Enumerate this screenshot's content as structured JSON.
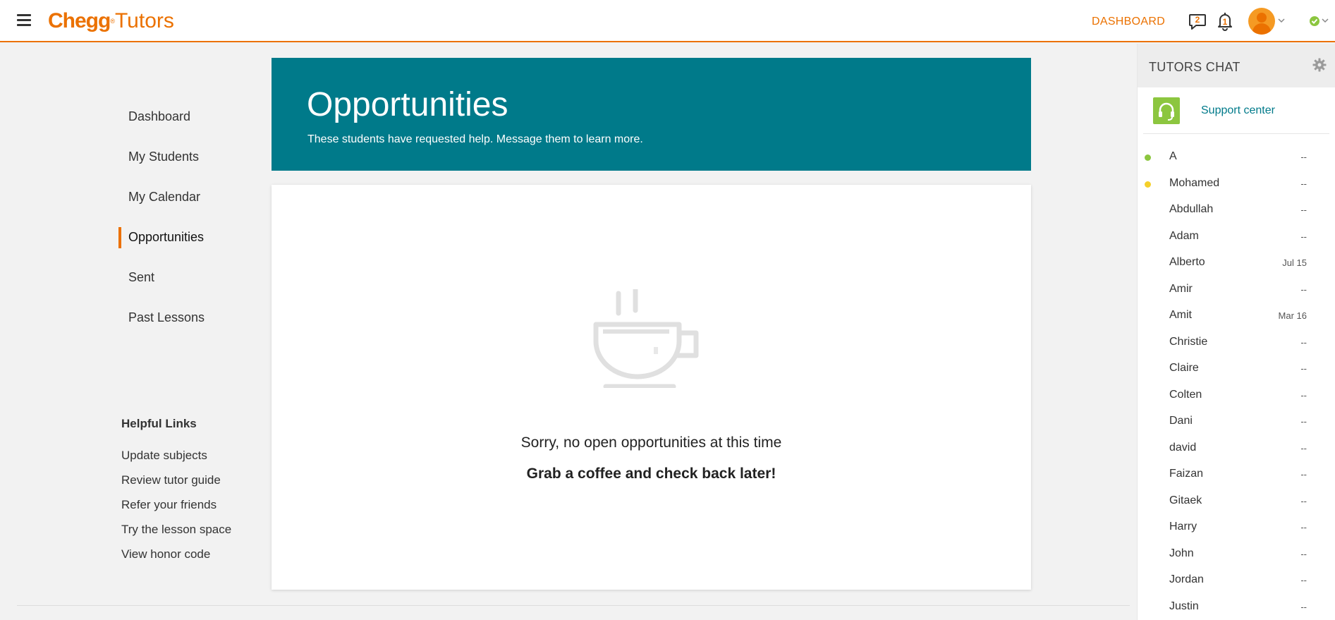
{
  "header": {
    "brand": "Chegg",
    "brand_mark": "®",
    "product": "Tutors",
    "dashboard_link": "DASHBOARD",
    "messages_count": "2",
    "notifications_count": "1",
    "brand_color": "#eb7100",
    "status_color": "#8cc63f"
  },
  "sidebar": {
    "items": [
      {
        "label": "Dashboard"
      },
      {
        "label": "My Students"
      },
      {
        "label": "My Calendar"
      },
      {
        "label": "Opportunities",
        "active": true
      },
      {
        "label": "Sent"
      },
      {
        "label": "Past Lessons"
      }
    ],
    "helpful_title": "Helpful Links",
    "helpful_links": [
      {
        "label": "Update subjects"
      },
      {
        "label": "Review tutor guide"
      },
      {
        "label": "Refer your friends"
      },
      {
        "label": "Try the lesson space"
      },
      {
        "label": "View honor code"
      }
    ]
  },
  "main": {
    "title": "Opportunities",
    "subtitle": "These students have requested help. Message them to learn more.",
    "empty_icon": "coffee-cup-icon",
    "empty_message": "Sorry, no open opportunities at this time",
    "empty_submessage": "Grab a coffee and check back later!",
    "hero_color": "#007a8a"
  },
  "chat": {
    "title": "TUTORS CHAT",
    "support_label": "Support center",
    "contacts": [
      {
        "name": "A",
        "date": "--",
        "status": "online",
        "color": "#8cc63f"
      },
      {
        "name": "Mohamed",
        "date": "--",
        "status": "away",
        "color": "#f5d02a"
      },
      {
        "name": "Abdullah",
        "date": "--"
      },
      {
        "name": "Adam",
        "date": "--"
      },
      {
        "name": "Alberto",
        "date": "Jul 15"
      },
      {
        "name": "Amir",
        "date": "--"
      },
      {
        "name": "Amit",
        "date": "Mar 16"
      },
      {
        "name": "Christie",
        "date": "--"
      },
      {
        "name": "Claire",
        "date": "--"
      },
      {
        "name": "Colten",
        "date": "--"
      },
      {
        "name": "Dani",
        "date": "--"
      },
      {
        "name": "david",
        "date": "--"
      },
      {
        "name": "Faizan",
        "date": "--"
      },
      {
        "name": "Gitaek",
        "date": "--"
      },
      {
        "name": "Harry",
        "date": "--"
      },
      {
        "name": "John",
        "date": "--"
      },
      {
        "name": "Jordan",
        "date": "--"
      },
      {
        "name": "Justin",
        "date": "--"
      }
    ]
  }
}
